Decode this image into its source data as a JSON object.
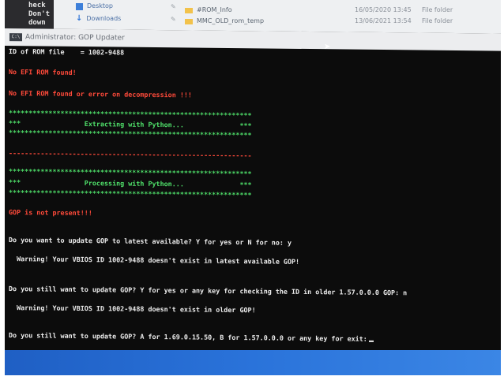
{
  "explorer": {
    "left_text": [
      "heck",
      "Don't",
      "down"
    ],
    "nav_items": [
      {
        "icon": "folder-icon",
        "label": "Desktop"
      },
      {
        "icon": "download-arrow-icon",
        "label": "Downloads"
      }
    ],
    "files": [
      {
        "name": "#ROM_Info",
        "date": "16/05/2020 13:45",
        "type": "File folder"
      },
      {
        "name": "MMC_OLD_rom_temp",
        "date": "13/06/2021 13:54",
        "type": "File folder"
      }
    ]
  },
  "window": {
    "title": "Administrator: GOP Updater",
    "icon": "cmd-window-icon"
  },
  "console": {
    "lines": [
      {
        "text": "ID of ROM file    = 1002-9488",
        "color": "white"
      },
      {
        "text": "No EFI ROM found!",
        "color": "red"
      },
      {
        "text": "No EFI ROM found or error on decompression !!!",
        "color": "red"
      },
      {
        "text": "*************************************************************",
        "color": "green"
      },
      {
        "text": "***                Extracting with Python...              ***",
        "color": "green"
      },
      {
        "text": "*************************************************************",
        "color": "green"
      },
      {
        "text": "-------------------------------------------------------------",
        "color": "red"
      },
      {
        "text": "*************************************************************",
        "color": "green"
      },
      {
        "text": "***                Processing with Python...              ***",
        "color": "green"
      },
      {
        "text": "*************************************************************",
        "color": "green"
      },
      {
        "text": "GOP is not present!!!",
        "color": "red"
      },
      {
        "text": "Do you want to update GOP to latest available? Y for yes or N for no: y",
        "color": "white"
      },
      {
        "text": "  Warning! Your VBIOS ID 1002-9488 doesn't exist in latest available GOP!",
        "color": "white"
      },
      {
        "text": "Do you still want to update GOP? Y for yes or any key for checking the ID in older 1.57.0.0.0 GOP: n",
        "color": "white"
      },
      {
        "text": "  Warning! Your VBIOS ID 1002-9488 doesn't exist in older GOP!",
        "color": "white"
      },
      {
        "text": "Do you still want to update GOP? A for 1.69.0.15.50, B for 1.57.0.0.0 or any key for exit:",
        "color": "white"
      }
    ]
  },
  "colors": {
    "green": "#4fe06a",
    "red": "#ff4a3a",
    "white": "#ececec",
    "console_bg": "#0c0c0c",
    "taskbar": "#2a73da"
  }
}
